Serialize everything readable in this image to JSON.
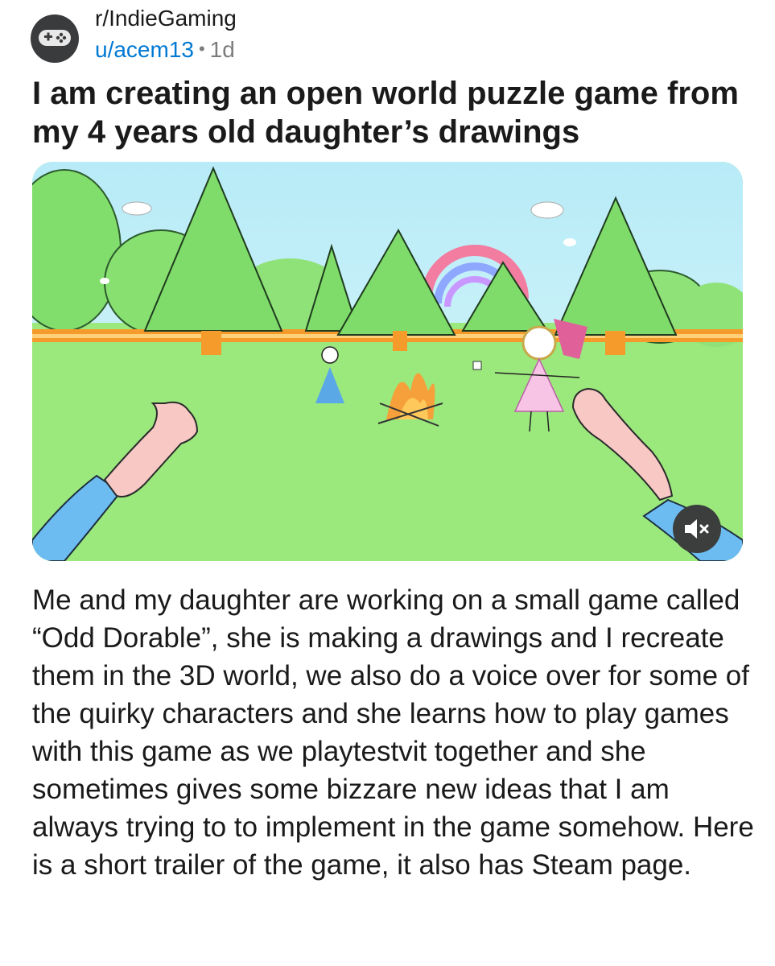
{
  "post": {
    "subreddit": "r/IndieGaming",
    "username": "u/acem13",
    "separator": "•",
    "age": "1d",
    "title": "I am creating an open world puzzle game from my 4 years old daughter’s drawings",
    "body": "Me and my daughter are working on a small game called “Odd Dorable”, she is making a drawings and I recreate them in the 3D world, we also do a voice over for some of the quirky characters and she learns how to play games with this game as we playtestvit together and she sometimes gives some bizzare new ideas that I am always trying to to implement in the game somehow. Here is a short trailer of the game, it also has Steam page."
  },
  "media": {
    "type": "video",
    "muted": true,
    "icons": {
      "avatar": "gamepad-icon",
      "mute": "speaker-muted-icon"
    }
  },
  "colors": {
    "username": "#0079d3",
    "meta_gray": "#7c7c7c",
    "sky": "#b7ebf7",
    "grass": "#9be87d",
    "tree": "#7fdc6a"
  }
}
